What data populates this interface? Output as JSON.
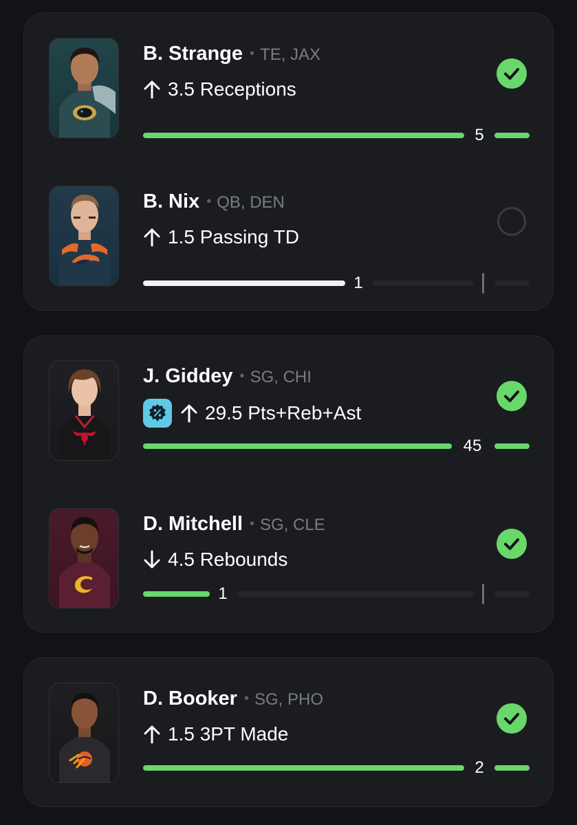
{
  "colors": {
    "background": "#121316",
    "card": "#1b1c20",
    "success_green": "#69d86b",
    "boost_cyan": "#5fc9e6",
    "muted_text": "#7a7c84"
  },
  "cards": [
    {
      "picks": [
        {
          "player_name": "B. Strange",
          "position_team": "TE, JAX",
          "direction": "up",
          "direction_icon": "arrow-up-icon",
          "line": "3.5 Receptions",
          "has_boost": false,
          "status": "hit",
          "status_icon": "check-circle-icon",
          "result_value": "5",
          "progress_fraction": 1.0,
          "bar_style": "green",
          "team_logo": "jaguars-logo"
        },
        {
          "player_name": "B. Nix",
          "position_team": "QB, DEN",
          "direction": "up",
          "direction_icon": "arrow-up-icon",
          "line": "1.5 Passing TD",
          "has_boost": false,
          "status": "pending",
          "status_icon": "empty-circle-icon",
          "result_value": "1",
          "progress_fraction": 0.6,
          "bar_style": "white",
          "team_logo": "broncos-logo"
        }
      ]
    },
    {
      "picks": [
        {
          "player_name": "J. Giddey",
          "position_team": "SG, CHI",
          "direction": "up",
          "direction_icon": "arrow-up-icon",
          "line": "29.5 Pts+Reb+Ast",
          "has_boost": true,
          "boost_icon": "discount-badge-icon",
          "status": "hit",
          "status_icon": "check-circle-icon",
          "result_value": "45",
          "progress_fraction": 1.0,
          "bar_style": "green",
          "team_logo": "bulls-logo"
        },
        {
          "player_name": "D. Mitchell",
          "position_team": "SG, CLE",
          "direction": "down",
          "direction_icon": "arrow-down-icon",
          "line": "4.5 Rebounds",
          "has_boost": false,
          "status": "hit",
          "status_icon": "check-circle-icon",
          "result_value": "1",
          "progress_fraction": 0.22,
          "bar_style": "green",
          "team_logo": "cavaliers-logo"
        }
      ]
    },
    {
      "picks": [
        {
          "player_name": "D. Booker",
          "position_team": "SG, PHO",
          "direction": "up",
          "direction_icon": "arrow-up-icon",
          "line": "1.5 3PT Made",
          "has_boost": false,
          "status": "hit",
          "status_icon": "check-circle-icon",
          "result_value": "2",
          "progress_fraction": 1.0,
          "bar_style": "green",
          "team_logo": "suns-logo"
        }
      ]
    }
  ]
}
